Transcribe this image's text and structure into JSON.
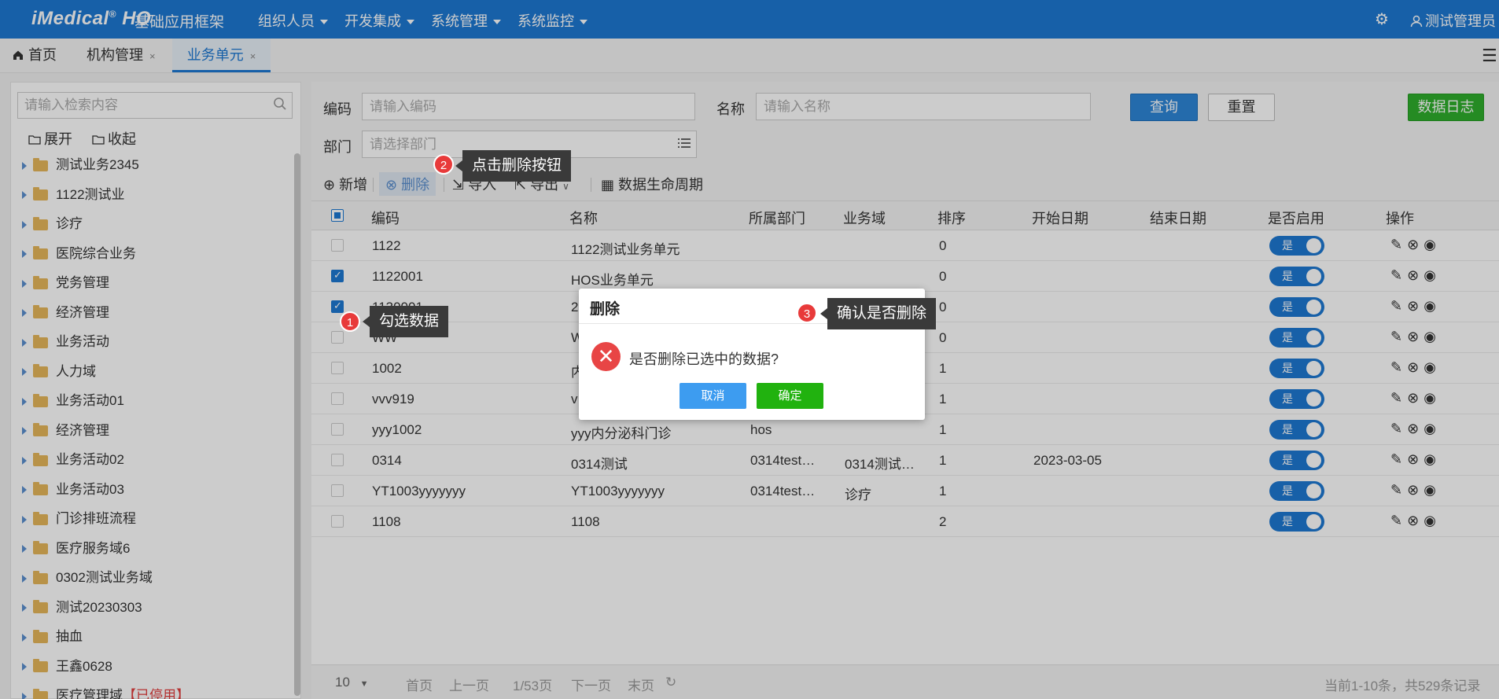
{
  "header": {
    "logo": "iMedical",
    "logo_reg": "®",
    "logo_suffix": "HO",
    "app_name": "基础应用框架",
    "menus": [
      {
        "label": "组织人员"
      },
      {
        "label": "开发集成"
      },
      {
        "label": "系统管理"
      },
      {
        "label": "系统监控"
      }
    ],
    "settings_icon": "⚙",
    "user": "测试管理员"
  },
  "tabs": {
    "home": "首页",
    "org": "机构管理",
    "business": "业务单元",
    "close": "×"
  },
  "tree": {
    "search_placeholder": "请输入检索内容",
    "expand": "展开",
    "collapse": "收起",
    "nodes": [
      {
        "label": "测试业务2345"
      },
      {
        "label": "1122测试业"
      },
      {
        "label": "诊疗"
      },
      {
        "label": "医院综合业务"
      },
      {
        "label": "党务管理"
      },
      {
        "label": "经济管理"
      },
      {
        "label": "业务活动"
      },
      {
        "label": "人力域"
      },
      {
        "label": "业务活动01"
      },
      {
        "label": "经济管理"
      },
      {
        "label": "业务活动02"
      },
      {
        "label": "业务活动03"
      },
      {
        "label": "门诊排班流程"
      },
      {
        "label": "医疗服务域6"
      },
      {
        "label": "0302测试业务域"
      },
      {
        "label": "测试20230303"
      },
      {
        "label": "抽血"
      },
      {
        "label": "王鑫0628"
      },
      {
        "label": "医疗管理域",
        "status": "【已停用】"
      }
    ]
  },
  "filters": {
    "code_label": "编码",
    "code_placeholder": "请输入编码",
    "name_label": "名称",
    "name_placeholder": "请输入名称",
    "dept_label": "部门",
    "dept_placeholder": "请选择部门",
    "query": "查询",
    "reset": "重置",
    "data_log": "数据日志"
  },
  "toolbar": {
    "add": "新增",
    "delete": "删除",
    "import": "导入",
    "export": "导出",
    "lifecycle": "数据生命周期"
  },
  "table": {
    "columns": [
      "编码",
      "名称",
      "所属部门",
      "业务域",
      "排序",
      "开始日期",
      "结束日期",
      "是否启用",
      "操作"
    ],
    "rows": [
      {
        "checked": false,
        "code": "1122",
        "name": "1122测试业务单元",
        "dept": "",
        "domain": "",
        "order": "0",
        "start": "",
        "end": "",
        "enabled": "是"
      },
      {
        "checked": true,
        "code": "1122001",
        "name": "HOS业务单元",
        "dept": "",
        "domain": "",
        "order": "0",
        "start": "",
        "end": "",
        "enabled": "是"
      },
      {
        "checked": true,
        "code": "1130001",
        "name": "2",
        "dept": "",
        "domain": "",
        "order": "0",
        "start": "",
        "end": "",
        "enabled": "是"
      },
      {
        "checked": false,
        "code": "WW",
        "name": "W",
        "dept": "",
        "domain": "",
        "order": "0",
        "start": "",
        "end": "",
        "enabled": "是"
      },
      {
        "checked": false,
        "code": "1002",
        "name": "内",
        "dept": "",
        "domain": "",
        "order": "1",
        "start": "",
        "end": "",
        "enabled": "是"
      },
      {
        "checked": false,
        "code": "vvv919",
        "name": "v",
        "dept": "",
        "domain": "",
        "order": "1",
        "start": "",
        "end": "",
        "enabled": "是"
      },
      {
        "checked": false,
        "code": "yyy1002",
        "name": "yyy内分泌科门诊",
        "dept": "hos",
        "domain": "",
        "order": "1",
        "start": "",
        "end": "",
        "enabled": "是"
      },
      {
        "checked": false,
        "code": "0314",
        "name": "0314测试",
        "dept": "0314test…",
        "domain": "0314测试…",
        "order": "1",
        "start": "2023-03-05",
        "end": "",
        "enabled": "是"
      },
      {
        "checked": false,
        "code": "YT1003yyyyyyy",
        "name": "YT1003yyyyyyy",
        "dept": "0314test…",
        "domain": "诊疗",
        "order": "1",
        "start": "",
        "end": "",
        "enabled": "是"
      },
      {
        "checked": false,
        "code": "1108",
        "name": "1108",
        "dept": "",
        "domain": "",
        "order": "2",
        "start": "",
        "end": "",
        "enabled": "是"
      }
    ]
  },
  "pager": {
    "page_size": "10",
    "first": "首页",
    "prev": "上一页",
    "page_info": "1/53页",
    "next": "下一页",
    "last": "末页",
    "summary": "当前1-10条，共529条记录"
  },
  "dialog": {
    "title": "删除",
    "message": "是否删除已选中的数据?",
    "cancel": "取消",
    "ok": "确定"
  },
  "callouts": [
    {
      "num": "1",
      "text": "勾选数据"
    },
    {
      "num": "2",
      "text": "点击删除按钮"
    },
    {
      "num": "3",
      "text": "确认是否删除"
    }
  ],
  "colors": {
    "brand": "#1d78d2",
    "success": "#2fae2c",
    "danger": "#e84545"
  }
}
